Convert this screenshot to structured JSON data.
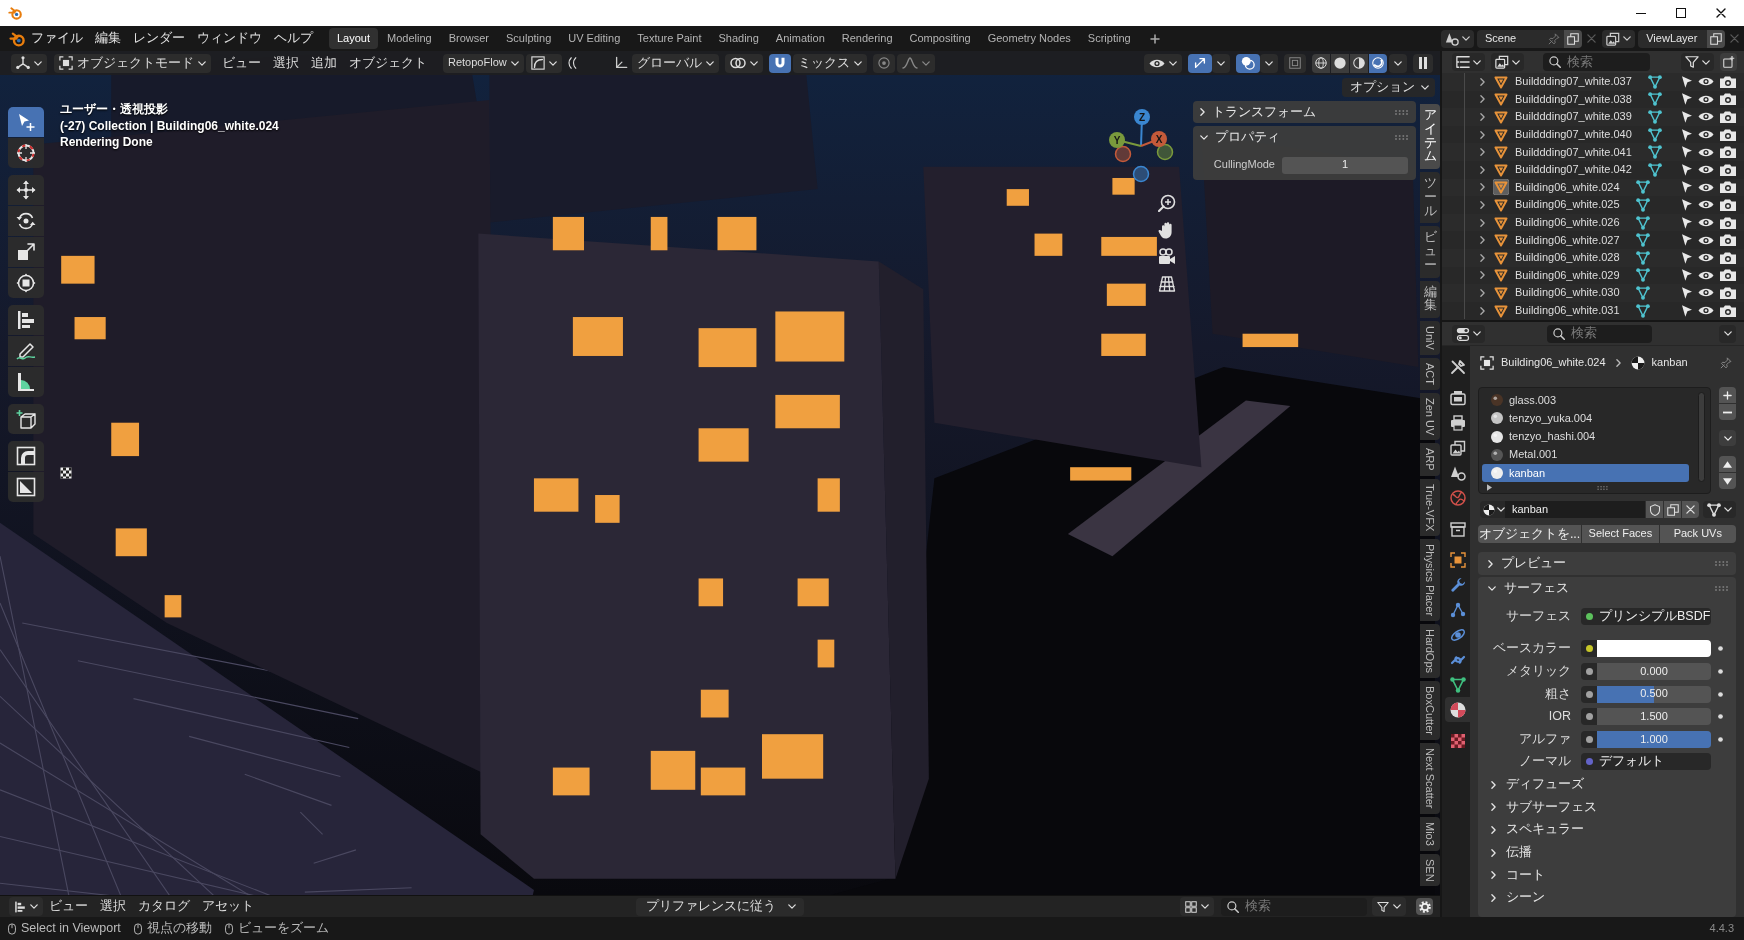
{
  "menu_bar": {
    "menus": [
      "ファイル",
      "編集",
      "レンダー",
      "ウィンドウ",
      "ヘルプ"
    ],
    "workspaces": [
      {
        "label": "Layout",
        "selected": true
      },
      {
        "label": "Modeling",
        "selected": false
      },
      {
        "label": "Browser",
        "selected": false
      },
      {
        "label": "Sculpting",
        "selected": false
      },
      {
        "label": "UV Editing",
        "selected": false
      },
      {
        "label": "Texture Paint",
        "selected": false
      },
      {
        "label": "Shading",
        "selected": false
      },
      {
        "label": "Animation",
        "selected": false
      },
      {
        "label": "Rendering",
        "selected": false
      },
      {
        "label": "Compositing",
        "selected": false
      },
      {
        "label": "Geometry Nodes",
        "selected": false
      },
      {
        "label": "Scripting",
        "selected": false
      }
    ],
    "scene": "Scene",
    "view_layer": "ViewLayer"
  },
  "viewport": {
    "header": {
      "mode": "オブジェクトモード",
      "menus": [
        "ビュー",
        "選択",
        "追加",
        "オブジェクト"
      ],
      "addon_menu": "RetopoFlow",
      "orientation": "グローバル",
      "snap_on": true,
      "snap_target": "ミックス",
      "gizmos_on": true,
      "overlays_on": true,
      "xray_on": false,
      "shading": [
        {
          "kind": "wireframe",
          "selected": false
        },
        {
          "kind": "solid",
          "selected": false
        },
        {
          "kind": "material",
          "selected": false
        },
        {
          "kind": "rendered",
          "selected": true
        }
      ]
    },
    "toolbar": [
      {
        "tools": [
          {
            "kind": "select",
            "selected": true
          },
          {
            "kind": "cursor",
            "selected": false
          }
        ]
      },
      {
        "tools": [
          {
            "kind": "move",
            "selected": false
          },
          {
            "kind": "rotate",
            "selected": false
          },
          {
            "kind": "scale",
            "selected": false
          },
          {
            "kind": "transform",
            "selected": false
          }
        ]
      },
      {
        "tools": [
          {
            "kind": "align",
            "selected": false
          },
          {
            "kind": "annotate",
            "selected": false
          },
          {
            "kind": "measure",
            "selected": false
          }
        ]
      },
      {
        "tools": [
          {
            "kind": "add_cube",
            "selected": false
          }
        ]
      },
      {
        "tools": [
          {
            "kind": "arc",
            "selected": false
          },
          {
            "kind": "triangle",
            "selected": false
          }
        ]
      }
    ],
    "overlay_text": [
      "ユーザー・透視投影",
      "(-27) Collection | Building06_white.024",
      "Rendering Done"
    ],
    "gizmo_axes": [
      {
        "label": "Z",
        "color": "#3a86d0"
      },
      {
        "label": "Y",
        "color": "#7a9a3c"
      },
      {
        "label": "X",
        "color": "#c45a3a"
      }
    ],
    "options_button": "オプション",
    "sidebar_panels": [
      {
        "title": "トランスフォーム",
        "expanded": false
      },
      {
        "title": "プロパティ",
        "expanded": true,
        "fields": [
          {
            "label": "CullingMode",
            "value": "1"
          }
        ]
      }
    ],
    "sidebar_tabs": [
      {
        "label": "アイテム",
        "kind": "stacked",
        "selected": true
      },
      {
        "label": "ツール",
        "kind": "stacked",
        "selected": false
      },
      {
        "label": "ビュー",
        "kind": "stacked",
        "selected": false
      },
      {
        "label": "編集",
        "kind": "stacked",
        "selected": false
      },
      {
        "label": "UniV",
        "kind": "rotated",
        "selected": false
      },
      {
        "label": "ACT",
        "kind": "rotated",
        "selected": false
      },
      {
        "label": "Zen UV",
        "kind": "rotated",
        "selected": false
      },
      {
        "label": "ARP",
        "kind": "rotated",
        "selected": false
      },
      {
        "label": "True-VFX",
        "kind": "rotated",
        "selected": false
      },
      {
        "label": "Physics Placer",
        "kind": "rotated",
        "selected": false
      },
      {
        "label": "HardOps",
        "kind": "rotated",
        "selected": false
      },
      {
        "label": "BoxCutter",
        "kind": "rotated",
        "selected": false
      },
      {
        "label": "Next Scatter",
        "kind": "rotated",
        "selected": false
      },
      {
        "label": "Mio3",
        "kind": "rotated",
        "selected": false
      },
      {
        "label": "SEN",
        "kind": "rotated",
        "selected": false
      }
    ]
  },
  "asset_bar": {
    "menus": [
      "ビュー",
      "選択",
      "カタログ",
      "アセット"
    ],
    "import_method": "プリファレンスに従う",
    "search": {
      "placeholder": "検索"
    }
  },
  "outliner": {
    "search": {
      "placeholder": "検索"
    },
    "rows": [
      {
        "name": "Builddding07_white.037",
        "active": false
      },
      {
        "name": "Builddding07_white.038",
        "active": false
      },
      {
        "name": "Builddding07_white.039",
        "active": false
      },
      {
        "name": "Builddding07_white.040",
        "active": false
      },
      {
        "name": "Builddding07_white.041",
        "active": false
      },
      {
        "name": "Builddding07_white.042",
        "active": false
      },
      {
        "name": "Building06_white.024",
        "active": true
      },
      {
        "name": "Building06_white.025",
        "active": false
      },
      {
        "name": "Building06_white.026",
        "active": false
      },
      {
        "name": "Building06_white.027",
        "active": false
      },
      {
        "name": "Building06_white.028",
        "active": false
      },
      {
        "name": "Building06_white.029",
        "active": false
      },
      {
        "name": "Building06_white.030",
        "active": false
      },
      {
        "name": "Building06_white.031",
        "active": false
      }
    ]
  },
  "properties": {
    "search": {
      "placeholder": "検索"
    },
    "tab_groups": [
      {
        "tabs": [
          {
            "kind": "tool",
            "selected": false
          }
        ]
      },
      {
        "tabs": [
          {
            "kind": "render",
            "selected": false
          },
          {
            "kind": "output",
            "selected": false
          },
          {
            "kind": "view_layer",
            "selected": false
          },
          {
            "kind": "scene",
            "selected": false
          },
          {
            "kind": "world",
            "selected": false
          }
        ]
      },
      {
        "tabs": [
          {
            "kind": "collection",
            "selected": false
          }
        ]
      },
      {
        "tabs": [
          {
            "kind": "object",
            "selected": false
          },
          {
            "kind": "modifier",
            "selected": false
          },
          {
            "kind": "particles",
            "selected": false
          },
          {
            "kind": "physics",
            "selected": false
          },
          {
            "kind": "constraints",
            "selected": false
          },
          {
            "kind": "data",
            "selected": false
          },
          {
            "kind": "material",
            "selected": true
          }
        ]
      },
      {
        "tabs": [
          {
            "kind": "texture",
            "selected": false
          }
        ]
      }
    ],
    "object_name": "Building06_white.024",
    "material_name": "kanban",
    "slots": [
      {
        "name": "glass.003",
        "color": "#4a3426",
        "selected": false
      },
      {
        "name": "tenzyo_yuka.004",
        "color": "#c4c4c4",
        "selected": false
      },
      {
        "name": "tenzyo_hashi.004",
        "color": "#e6e6e6",
        "selected": false
      },
      {
        "name": "Metal.001",
        "color": "#555555",
        "selected": false
      },
      {
        "name": "kanban",
        "color": "#eeeeee",
        "selected": true
      }
    ],
    "datablock_name": "kanban",
    "buttons": [
      "オブジェクトを...",
      "Select Faces",
      "Pack UVs"
    ],
    "panels": [
      {
        "title": "プレビュー",
        "expanded": false
      },
      {
        "title": "サーフェス",
        "expanded": true,
        "rows": [
          {
            "kind": "shader",
            "label": "サーフェス",
            "color": "#5cc15c",
            "value": "プリンシプルBSDF"
          },
          {
            "kind": "color",
            "label": "ベースカラー",
            "color": "#c7c729",
            "swatch": {
              "color": "#ffffff"
            }
          },
          {
            "kind": "number",
            "label": "メタリック",
            "color": "#a1a1a1",
            "value": "0.000"
          },
          {
            "kind": "slider",
            "label": "粗さ",
            "color": "#a1a1a1",
            "value": "0.500",
            "level": 0.5
          },
          {
            "kind": "number",
            "label": "IOR",
            "color": "#a1a1a1",
            "value": "1.500"
          },
          {
            "kind": "slider",
            "label": "アルファ",
            "color": "#a1a1a1",
            "value": "1.000",
            "level": 1
          },
          {
            "kind": "vector",
            "label": "ノーマル",
            "color": "#6363c7",
            "value": "デフォルト"
          }
        ],
        "subpanels": [
          {
            "title": "ディフューズ",
            "expanded": false
          },
          {
            "title": "サブサーフェス",
            "expanded": false
          },
          {
            "title": "スペキュラー",
            "expanded": false
          },
          {
            "title": "伝播",
            "expanded": false
          },
          {
            "title": "コート",
            "expanded": false
          },
          {
            "title": "シーン",
            "expanded": false
          }
        ]
      }
    ]
  },
  "status_bar": {
    "hints": [
      "Select in Viewport",
      "視点の移動",
      "ビューをズーム"
    ],
    "version": "4.4.3"
  }
}
